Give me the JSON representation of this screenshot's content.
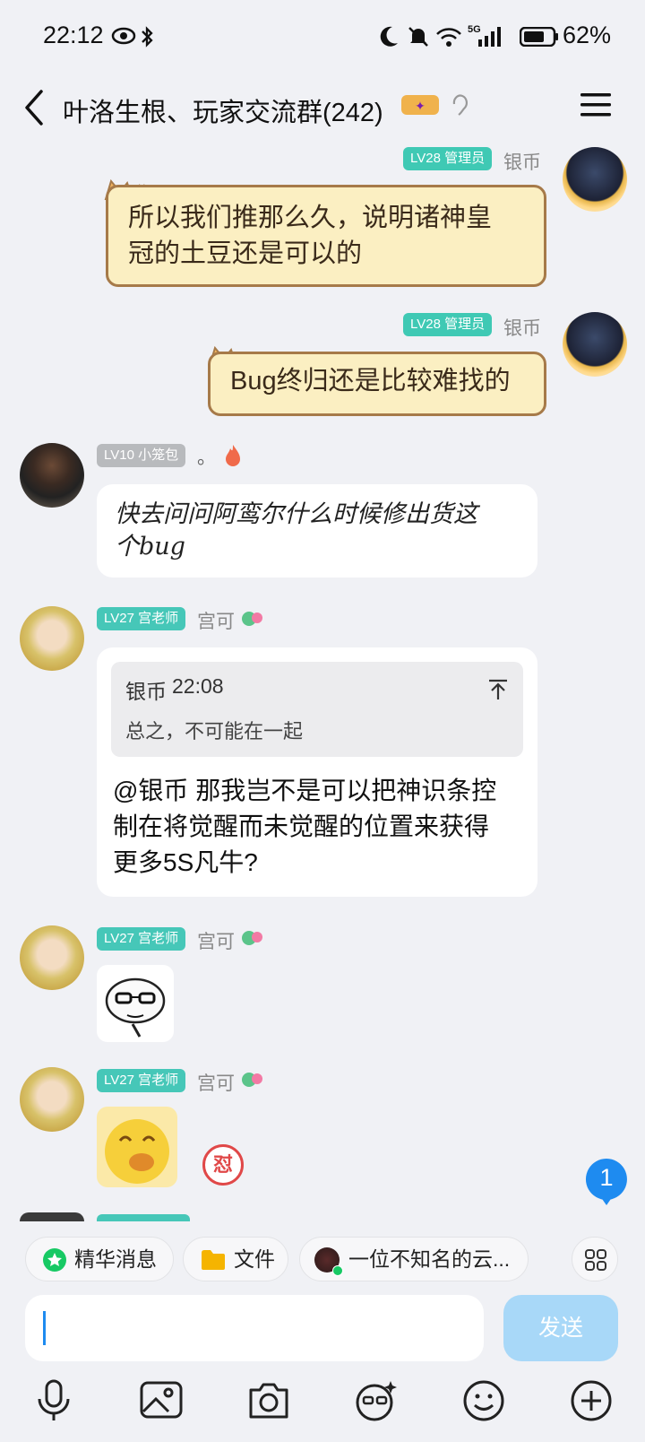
{
  "status_bar": {
    "time": "22:12",
    "battery_percent": "62%",
    "network": "5G"
  },
  "header": {
    "title": "叶洛生根、玩家交流群(242)"
  },
  "messages": [
    {
      "side": "right",
      "level": "LV28 管理员",
      "nickname": "银币",
      "text_lines": [
        "所以我们推那么久，说明诸神皇",
        "冠的土豆还是可以的"
      ]
    },
    {
      "side": "right",
      "level": "LV28 管理员",
      "nickname": "银币",
      "text": "Bug终归还是比较难找的"
    },
    {
      "side": "left",
      "level": "LV10 小笼包",
      "nickname": "。",
      "text_lines": [
        "快去问问阿鸾尔什么时候修出货这",
        "个bug"
      ]
    },
    {
      "side": "left",
      "level": "LV27 宫老师",
      "nickname": "宫可",
      "quote_author": "银币",
      "quote_time": "22:08",
      "quote_text": "总之，不可能在一起",
      "text_lines": [
        "@银币 那我岂不是可以把神识条控",
        "制在将觉醒而未觉醒的位置来获得",
        "更多5S凡牛?"
      ]
    },
    {
      "side": "left",
      "level": "LV27 宫老师",
      "nickname": "宫可",
      "sticker": "sticker-icon"
    },
    {
      "side": "left",
      "level": "LV27 宫老师",
      "nickname": "宫可",
      "sticker": "sticker-icon",
      "reaction_text": "怼"
    }
  ],
  "unread_count": "1",
  "quick_chips": [
    {
      "label": "精华消息",
      "icon": "star-icon",
      "color": "#17c964"
    },
    {
      "label": "文件",
      "icon": "folder-icon",
      "color": "#f5b400"
    },
    {
      "label": "一位不知名的云...",
      "icon": "avatar-icon"
    }
  ],
  "input": {
    "placeholder": "",
    "send_label": "发送"
  },
  "toolbar": [
    "mic-icon",
    "image-icon",
    "camera-icon",
    "face-effect-icon",
    "emoji-icon",
    "plus-icon"
  ],
  "colors": {
    "background": "#f0f1f5",
    "level_admin": "#3fc9b4",
    "level_grey": "#b8babd",
    "send_button": "#a8d8f8",
    "unread_badge": "#1e8bf0",
    "cat_bubble": "#fbefc2"
  }
}
